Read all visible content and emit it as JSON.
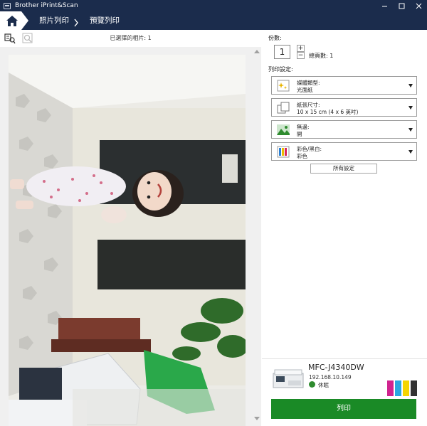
{
  "window": {
    "title": "Brother iPrint&Scan"
  },
  "nav": {
    "crumb_photo_print": "照片列印",
    "crumb_preview_print": "預覽列印"
  },
  "preview": {
    "selected_label": "已選擇的相片: 1"
  },
  "settings": {
    "copies_label": "份數:",
    "copies_value": "1",
    "plus_label": "+",
    "minus_label": "−",
    "total_label": "總頁數: 1",
    "print_settings_label": "列印設定:",
    "rows": [
      {
        "title": "媒體類型:",
        "value": "光面紙",
        "icon": "media-type-icon"
      },
      {
        "title": "紙張尺寸:",
        "value": "10 x 15 cm (4 x 6 英吋)",
        "icon": "paper-size-icon"
      },
      {
        "title": "無邊:",
        "value": "開",
        "icon": "borderless-icon"
      },
      {
        "title": "彩色/黑白:",
        "value": "彩色",
        "icon": "color-icon"
      }
    ],
    "all_settings_label": "所有設定"
  },
  "printer": {
    "model": "MFC-J4340DW",
    "ip": "192.168.10.149",
    "status": "休眠",
    "ink_colors": [
      "#d0238f",
      "#2aa7e0",
      "#f5d500",
      "#333333"
    ]
  },
  "actions": {
    "print_label": "列印"
  },
  "colors": {
    "header_bg": "#1b2c4c",
    "print_button": "#1a8a26"
  }
}
